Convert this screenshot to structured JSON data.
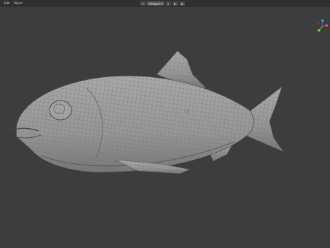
{
  "header": {
    "menu": [
      "Edit",
      "Object"
    ],
    "shading_select": "Viewport",
    "tools": [
      "≡",
      "⊙",
      "◐",
      "◉"
    ]
  },
  "viewport": {
    "object": "fish",
    "background_color": "#3d3d3d",
    "mesh_color": "#9a9a9a"
  },
  "gizmo": {
    "axes": [
      "x-axis",
      "y-axis",
      "z-axis"
    ],
    "colors": [
      "#e64c4c",
      "#6fbf3a",
      "#4a7ee6"
    ]
  }
}
